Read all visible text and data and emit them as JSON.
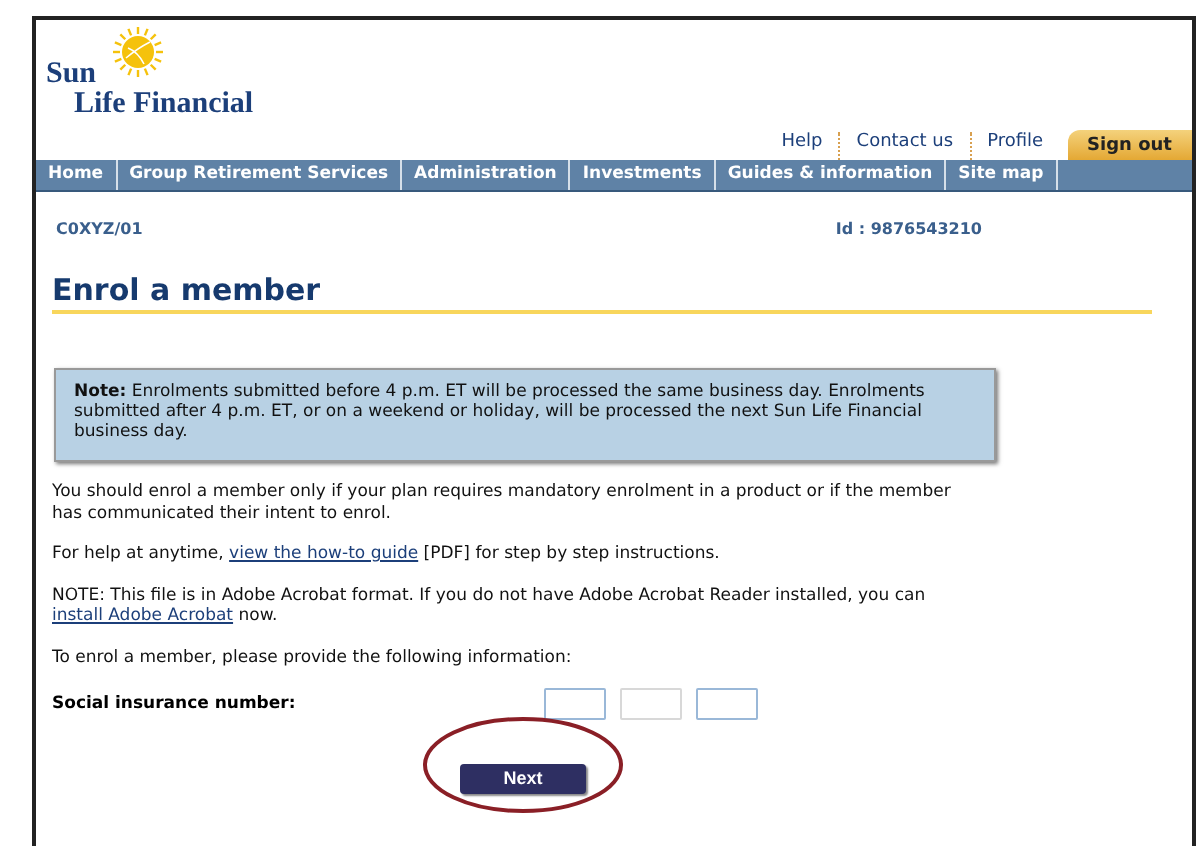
{
  "logo": {
    "line1": "Sun",
    "line2": "Life Financial"
  },
  "utility_links": [
    {
      "label": "Help",
      "kind": "link"
    },
    {
      "label": "Contact us",
      "kind": "link"
    },
    {
      "label": "Profile",
      "kind": "link"
    },
    {
      "label": "Sign out",
      "kind": "tab"
    }
  ],
  "nav": [
    {
      "label": "Home"
    },
    {
      "label": "Group Retirement Services"
    },
    {
      "label": "Administration"
    },
    {
      "label": "Investments"
    },
    {
      "label": "Guides & information"
    },
    {
      "label": "Site map"
    }
  ],
  "account": {
    "code": "C0XYZ/01",
    "id": "Id : 9876543210"
  },
  "title": "Enrol a member",
  "note": "**Note:** Enrolments submitted before 4 p.m. ET will be processed the same business day. Enrolments submitted after 4 p.m. ET, or on a weekend or holiday, will be processed the next Sun Life Financial business day.",
  "paragraphs": [
    [
      {
        "kind": "text",
        "text": "You should enrol a member only if your plan requires mandatory enrolment in a product or if the member has communicated their intent to enrol."
      }
    ],
    [
      {
        "kind": "text",
        "text": "For help at anytime, "
      },
      {
        "kind": "link",
        "text": "view the how-to guide"
      },
      {
        "kind": "text",
        "text": " [PDF] for step by step instructions."
      }
    ],
    [
      {
        "kind": "text",
        "text": "NOTE: This file is in Adobe Acrobat format. If you do not have Adobe Acrobat Reader installed, you can "
      },
      {
        "kind": "link",
        "text": "install Adobe Acrobat"
      },
      {
        "kind": "text",
        "text": " now."
      }
    ],
    [
      {
        "kind": "text",
        "text": "To enrol a member, please provide the following information:"
      }
    ]
  ],
  "sin": {
    "label": "Social insurance number:",
    "segments": [
      {
        "highlighted": true
      },
      {
        "highlighted": false
      },
      {
        "highlighted": true
      }
    ]
  },
  "next_button": {
    "label": "Next",
    "circled": true
  }
}
